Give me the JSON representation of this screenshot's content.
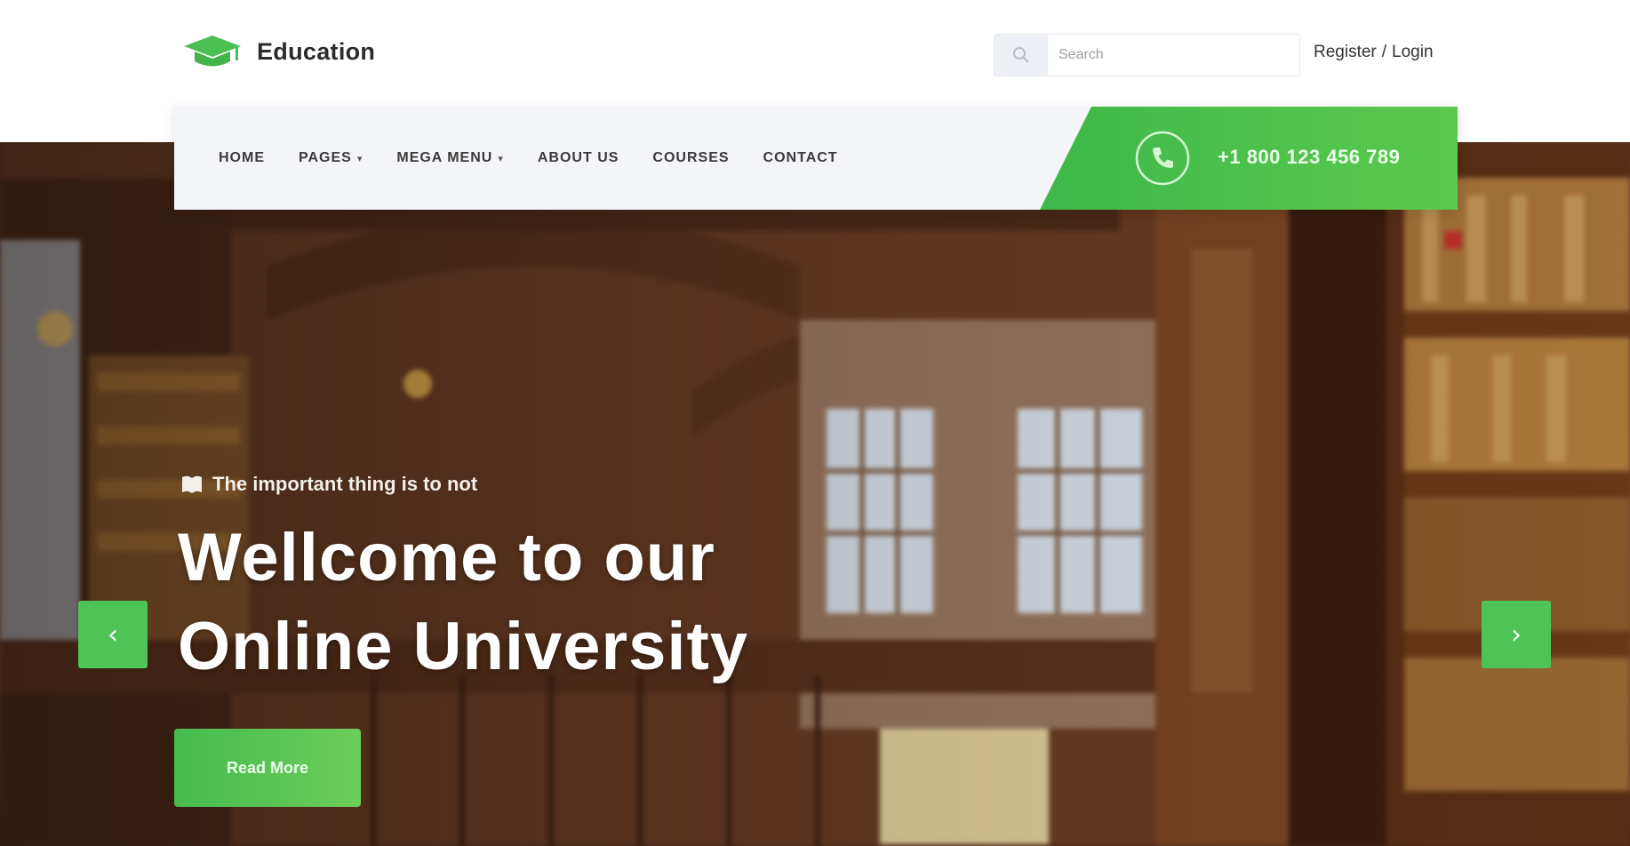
{
  "header": {
    "logo_text": "Education",
    "logo_icon": "graduation-cap-icon",
    "search": {
      "placeholder": "Search",
      "icon": "search-icon"
    },
    "register_label": "Register",
    "separator": "/",
    "login_label": "Login"
  },
  "nav": {
    "items": [
      {
        "label": "HOME",
        "dropdown": false
      },
      {
        "label": "PAGES",
        "dropdown": true
      },
      {
        "label": "MEGA MENU",
        "dropdown": true
      },
      {
        "label": "ABOUT US",
        "dropdown": false
      },
      {
        "label": "COURSES",
        "dropdown": false
      },
      {
        "label": "CONTACT",
        "dropdown": false
      }
    ],
    "phone": {
      "icon": "phone-icon",
      "number": "+1 800 123 456 789"
    }
  },
  "hero": {
    "kicker": "The important thing is to not",
    "kicker_icon": "book-icon",
    "headline_line1": "Wellcome to our",
    "headline_line2": "Online University",
    "cta_label": "Read More",
    "prev_icon": "chevron-left-icon",
    "next_icon": "chevron-right-icon"
  },
  "colors": {
    "accent": "#4cbf52",
    "accent_light": "#6ccd5a",
    "nav_bg": "#f4f5f9",
    "text_dark": "#2b2b2b"
  }
}
